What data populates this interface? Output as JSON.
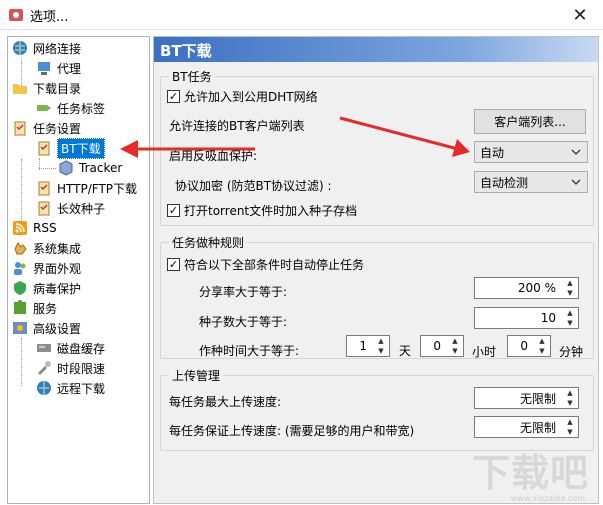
{
  "window": {
    "title": "选项..."
  },
  "tree": {
    "items": [
      {
        "label": "网络连接"
      },
      {
        "label": "代理"
      },
      {
        "label": "下载目录"
      },
      {
        "label": "任务标签"
      },
      {
        "label": "任务设置"
      },
      {
        "label": "BT下载"
      },
      {
        "label": "Tracker"
      },
      {
        "label": "HTTP/FTP下载"
      },
      {
        "label": "长效种子"
      },
      {
        "label": "RSS"
      },
      {
        "label": "系统集成"
      },
      {
        "label": "界面外观"
      },
      {
        "label": "病毒保护"
      },
      {
        "label": "服务"
      },
      {
        "label": "高级设置"
      },
      {
        "label": "磁盘缓存"
      },
      {
        "label": "时段限速"
      },
      {
        "label": "远程下载"
      }
    ]
  },
  "panel": {
    "title": "BT下载",
    "bt_group": {
      "title": "BT任务",
      "dht_label": "允许加入到公用DHT网络",
      "dht_checked": true,
      "client_list_label": "允许连接的BT客户端列表",
      "client_list_button": "客户端列表...",
      "anti_leech_label": "启用反吸血保护:",
      "anti_leech_value": "自动",
      "encryption_label": "协议加密 (防范BT协议过滤) :",
      "encryption_value": "自动检测",
      "torrent_archive_label": "打开torrent文件时加入种子存档",
      "torrent_archive_checked": true
    },
    "seed_group": {
      "title": "任务做种规则",
      "auto_stop_label": "符合以下全部条件时自动停止任务",
      "auto_stop_checked": true,
      "ratio_label": "分享率大于等于:",
      "ratio_value": "200 %",
      "seeds_label": "种子数大于等于:",
      "seeds_value": "10",
      "time_label": "作种时间大于等于:",
      "days_value": "1",
      "days_unit": "天",
      "hours_value": "0",
      "hours_unit": "小时",
      "minutes_value": "0",
      "minutes_unit": "分钟"
    },
    "upload_group": {
      "title": "上传管理",
      "max_upload_label": "每任务最大上传速度:",
      "max_upload_value": "无限制",
      "guaranteed_upload_label": "每任务保证上传速度: (需要足够的用户和带宽)",
      "guaranteed_upload_value": "无限制"
    }
  },
  "watermark": {
    "text": "下载吧",
    "sub": "www.xiazaiba.com"
  },
  "colors": {
    "header_start": "#3a6fc2",
    "selection": "#0078d7",
    "annotation_arrow": "#e52a2a"
  }
}
